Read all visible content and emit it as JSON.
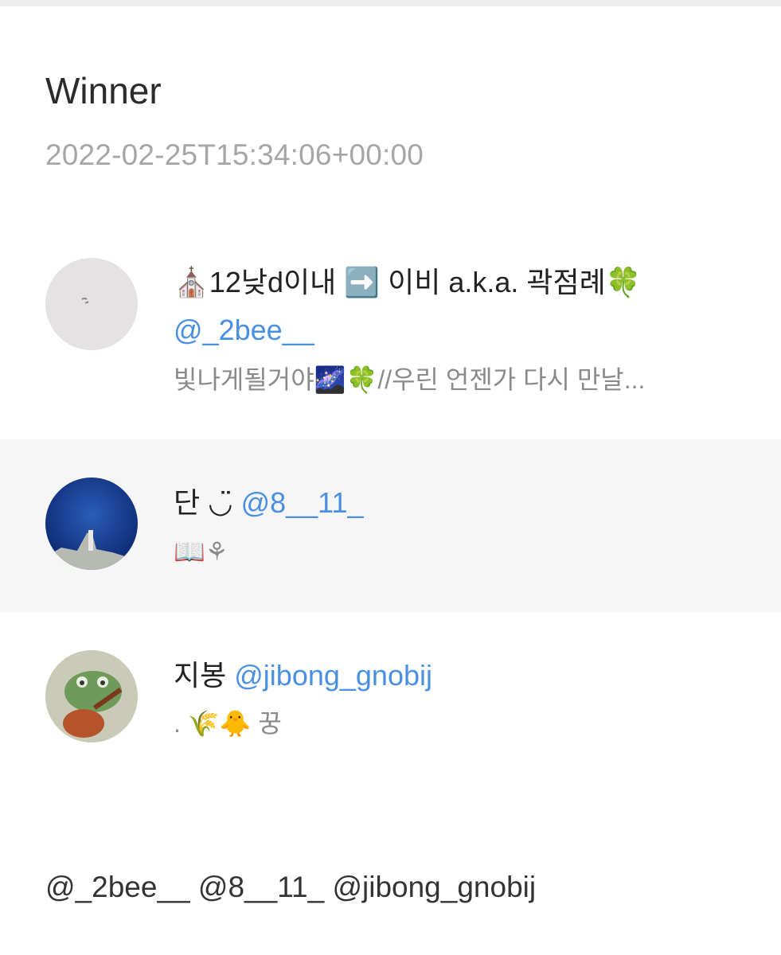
{
  "post": {
    "title": "Winner",
    "timestamp": "2022-02-25T15:34:06+00:00"
  },
  "winners": [
    {
      "display_name": "⛪12낮d이내 ➡️ 이비 a.k.a. 곽점례🍀",
      "handle": "@_2bee__",
      "bio": "빛나게될거야🌌🍀//우린 언젠가 다시 만날...",
      "avatar_icon": "white-paper-avatar"
    },
    {
      "display_name": "단 ◡̈",
      "handle": "@8__11_",
      "bio": "📖⚘",
      "avatar_icon": "blue-ocean-avatar"
    },
    {
      "display_name": "지봉",
      "handle": "@jibong_gnobij",
      "bio": ". 🌾🐥 꿍",
      "avatar_icon": "green-frog-avatar"
    }
  ],
  "mentions": "@_2bee__ @8__11_ @jibong_gnobij",
  "colors": {
    "handle": "#4a90e2",
    "highlight_row": "#f6f6f6",
    "timestamp": "#a6a6a6"
  }
}
